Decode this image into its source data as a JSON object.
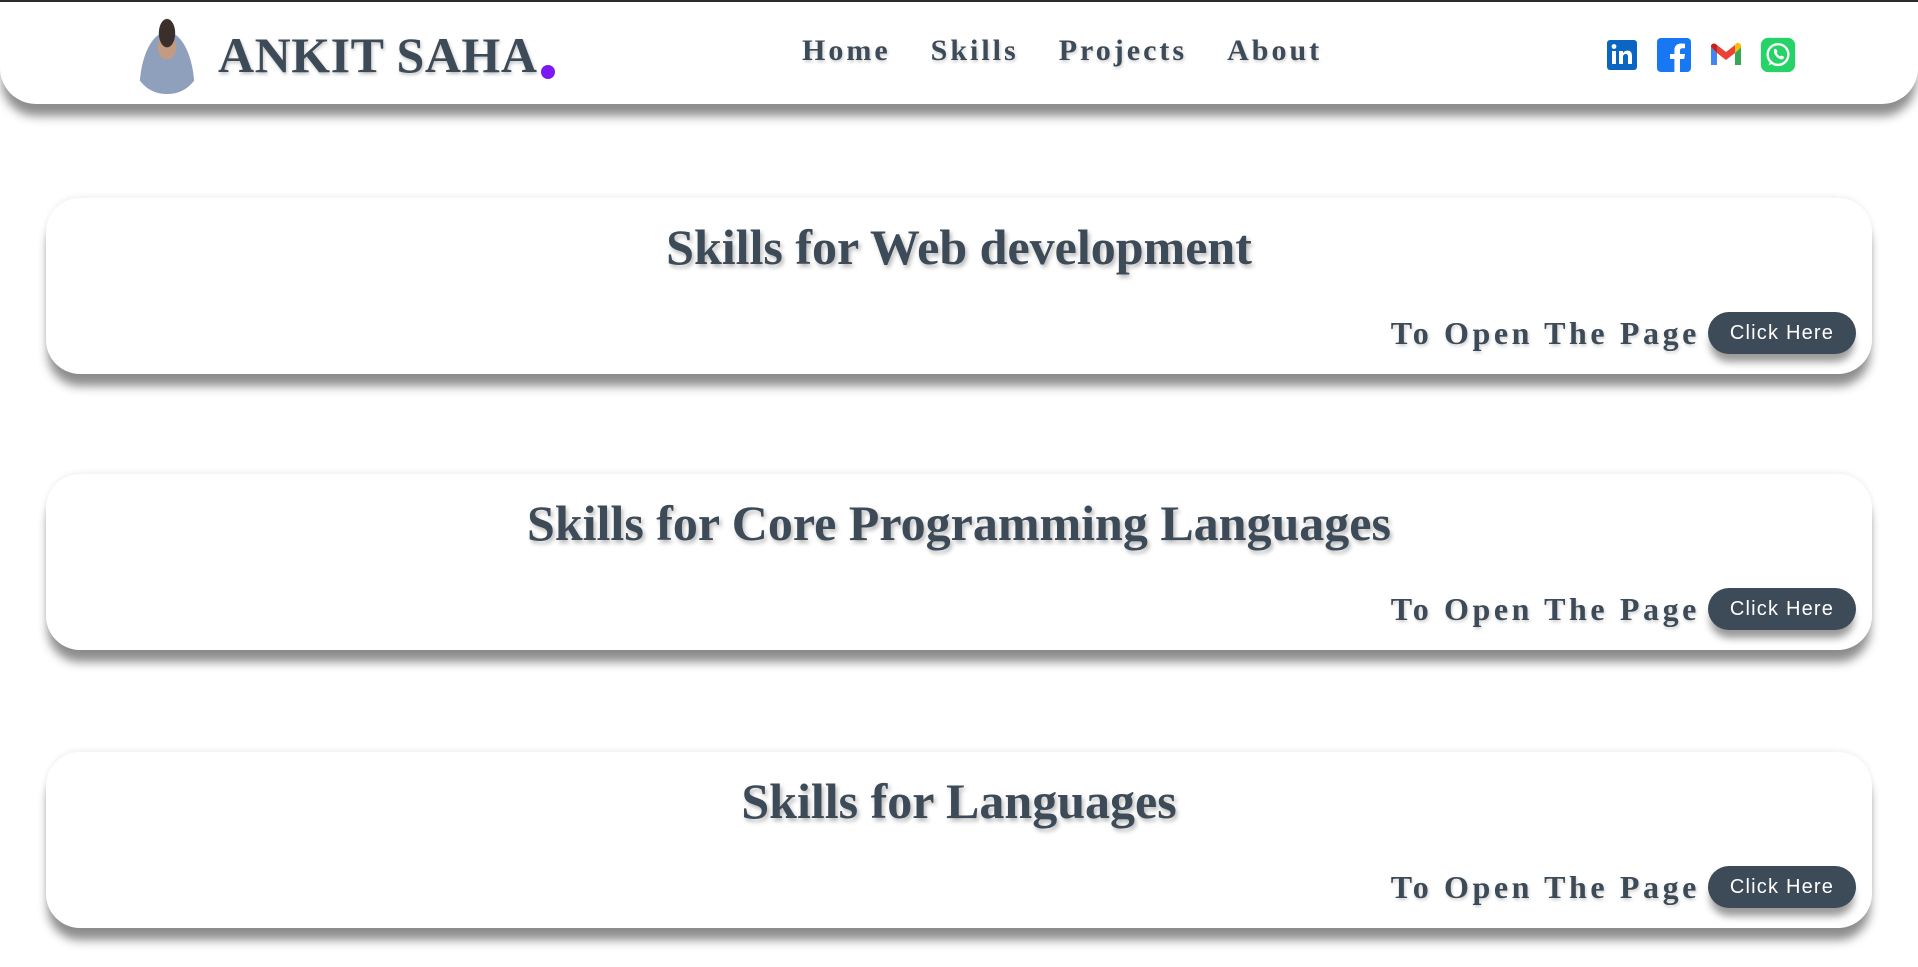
{
  "header": {
    "name": "ANKIT SAHA",
    "nav": [
      "Home",
      "Skills",
      "Projects",
      "About"
    ],
    "socials": [
      "linkedin-icon",
      "facebook-icon",
      "gmail-icon",
      "whatsapp-icon"
    ]
  },
  "cards": [
    {
      "title": "Skills for Web development",
      "open_text": "To Open The Page",
      "button": "Click Here"
    },
    {
      "title": "Skills for Core Programming Languages",
      "open_text": "To Open The Page",
      "button": "Click Here"
    },
    {
      "title": "Skills for Languages",
      "open_text": "To Open The Page",
      "button": "Click Here"
    }
  ],
  "colors": {
    "text": "#3d4a57",
    "accent_dot": "#7b19f2",
    "button": "#3d4a57",
    "linkedin": "#0a66c2",
    "facebook": "#1877f2",
    "whatsapp": "#25d366"
  }
}
